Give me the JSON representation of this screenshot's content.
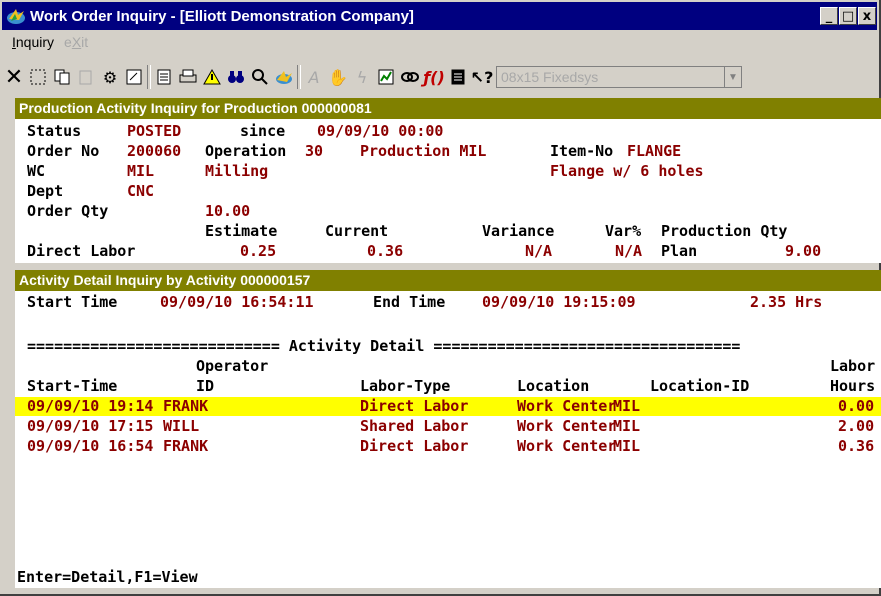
{
  "window": {
    "title": "Work Order Inquiry - [Elliott Demonstration Company]",
    "controls": {
      "minimize": "_",
      "maximize": "□",
      "close": "x"
    }
  },
  "menu": {
    "inquiry": "Inquiry",
    "exit": "eXit"
  },
  "toolbar": {
    "font_select": "08x15 Fixedsys",
    "icons": [
      "close-icon",
      "select-icon",
      "copy-icon",
      "paste-icon",
      "settings-icon",
      "properties-icon",
      "notes-icon",
      "print-icon",
      "alert-icon",
      "binoculars-icon",
      "search-icon",
      "globe-icon",
      "text-icon",
      "hands-icon",
      "lightning-icon",
      "chart-icon",
      "link-icon",
      "function-icon",
      "document-icon",
      "help-icon"
    ]
  },
  "production_panel": {
    "title": "Production Activity Inquiry for Production 000000081",
    "status_label": "Status",
    "status_value": "POSTED",
    "since_label": "since",
    "since_value": "09/09/10 00:00",
    "order_no_label": "Order No",
    "order_no_value": "200060",
    "operation_label": "Operation",
    "operation_value": "30",
    "operation_desc": "Production MIL",
    "item_no_label": "Item-No",
    "item_no_value": "FLANGE",
    "wc_label": "WC",
    "wc_value": "MIL",
    "wc_desc": "Milling",
    "item_desc": "Flange w/ 6 holes",
    "dept_label": "Dept",
    "dept_value": "CNC",
    "order_qty_label": "Order Qty",
    "order_qty_value": "10.00",
    "estimate_header": "Estimate",
    "current_header": "Current",
    "variance_header": "Variance",
    "varpct_header": "Var%",
    "prodqty_header": "Production Qty",
    "direct_labor_label": "Direct Labor",
    "direct_labor_estimate": "0.25",
    "direct_labor_current": "0.36",
    "direct_labor_variance": "N/A",
    "direct_labor_varpct": "N/A",
    "plan_label": "Plan",
    "plan_value": "9.00"
  },
  "activity_panel": {
    "title": "Activity Detail Inquiry by Activity 000000157",
    "start_time_label": "Start Time",
    "start_time_value": "09/09/10 16:54:11",
    "end_time_label": "End Time",
    "end_time_value": "09/09/10 19:15:09",
    "total_hours": "2.35 Hrs",
    "section_heading": "============================ Activity Detail ==================================",
    "col_operator_top": "Operator",
    "col_labor_top": "Labor",
    "columns": [
      "Start-Time",
      "ID",
      "Labor-Type",
      "Location",
      "Location-ID",
      "Hours"
    ],
    "rows": [
      [
        "09/09/10 19:14",
        "FRANK",
        "Direct Labor",
        "Work Center",
        "MIL",
        "0.00"
      ],
      [
        "09/09/10 17:15",
        "WILL",
        "Shared Labor",
        "Work Center",
        "MIL",
        "2.00"
      ],
      [
        "09/09/10 16:54",
        "FRANK",
        "Direct Labor",
        "Work Center",
        "MIL",
        "0.36"
      ]
    ],
    "footer": "Enter=Detail,F1=View"
  }
}
